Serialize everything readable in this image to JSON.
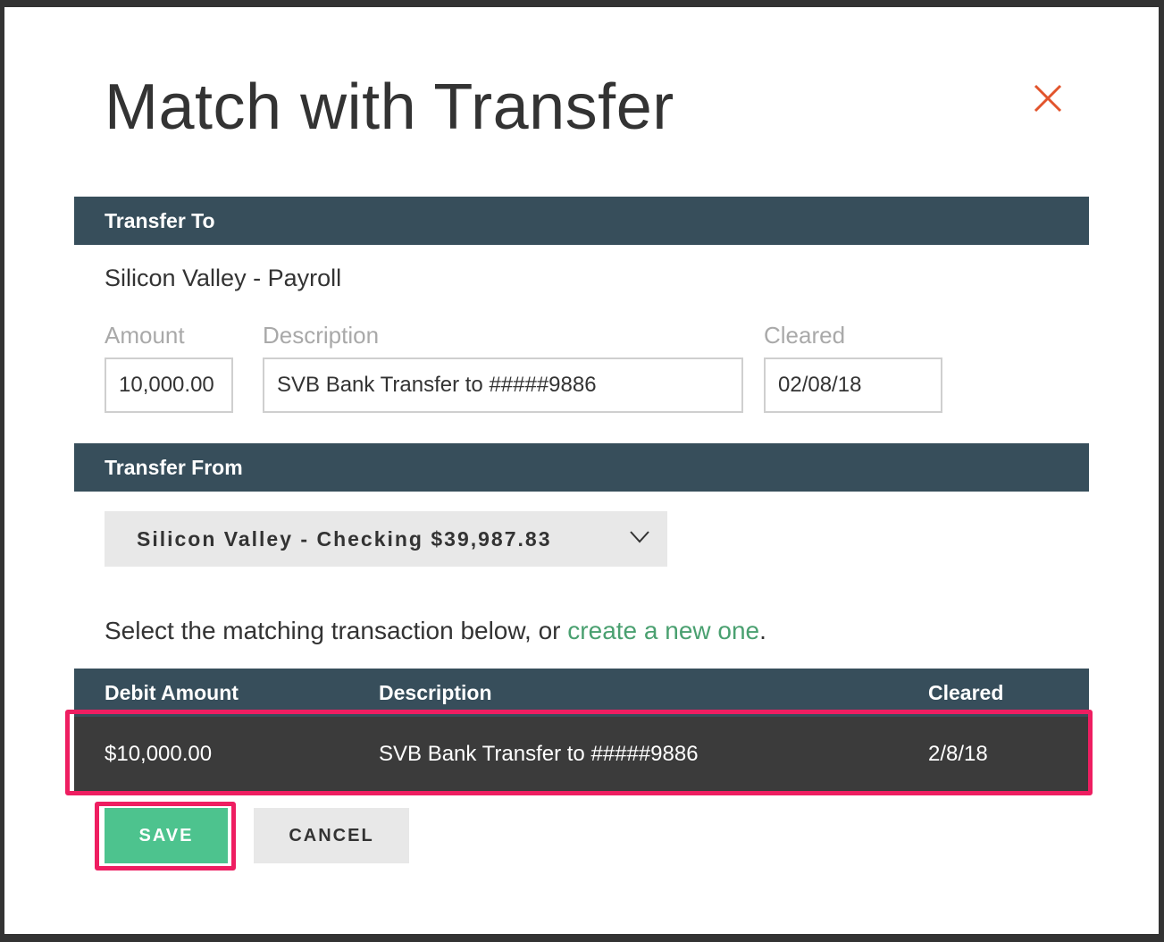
{
  "dialog": {
    "title": "Match with Transfer",
    "close_icon": "close-icon",
    "close_color": "#e2542c"
  },
  "transfer_to": {
    "heading": "Transfer To",
    "account": "Silicon Valley - Payroll",
    "amount_label": "Amount",
    "amount_value": "10,000.00",
    "description_label": "Description",
    "description_value": "SVB Bank Transfer to #####9886",
    "cleared_label": "Cleared",
    "cleared_value": "02/08/18"
  },
  "transfer_from": {
    "heading": "Transfer From",
    "selected_account": "Silicon Valley - Checking $39,987.83",
    "dropdown_icon": "chevron-down-icon"
  },
  "instruction": {
    "text_before": "Select the matching transaction below, or ",
    "link_text": "create a new one",
    "text_after": "."
  },
  "table": {
    "columns": [
      "Debit Amount",
      "Description",
      "Cleared"
    ],
    "rows": [
      [
        "$10,000.00",
        "SVB Bank Transfer to #####9886",
        "2/8/18"
      ]
    ]
  },
  "actions": {
    "save_label": "SAVE",
    "cancel_label": "CANCEL"
  },
  "colors": {
    "header_bar": "#374e5b",
    "selected_row": "#3b3b3b",
    "save_button": "#4dc38e",
    "link": "#4aa070",
    "highlight_outline": "#ee1e61"
  }
}
